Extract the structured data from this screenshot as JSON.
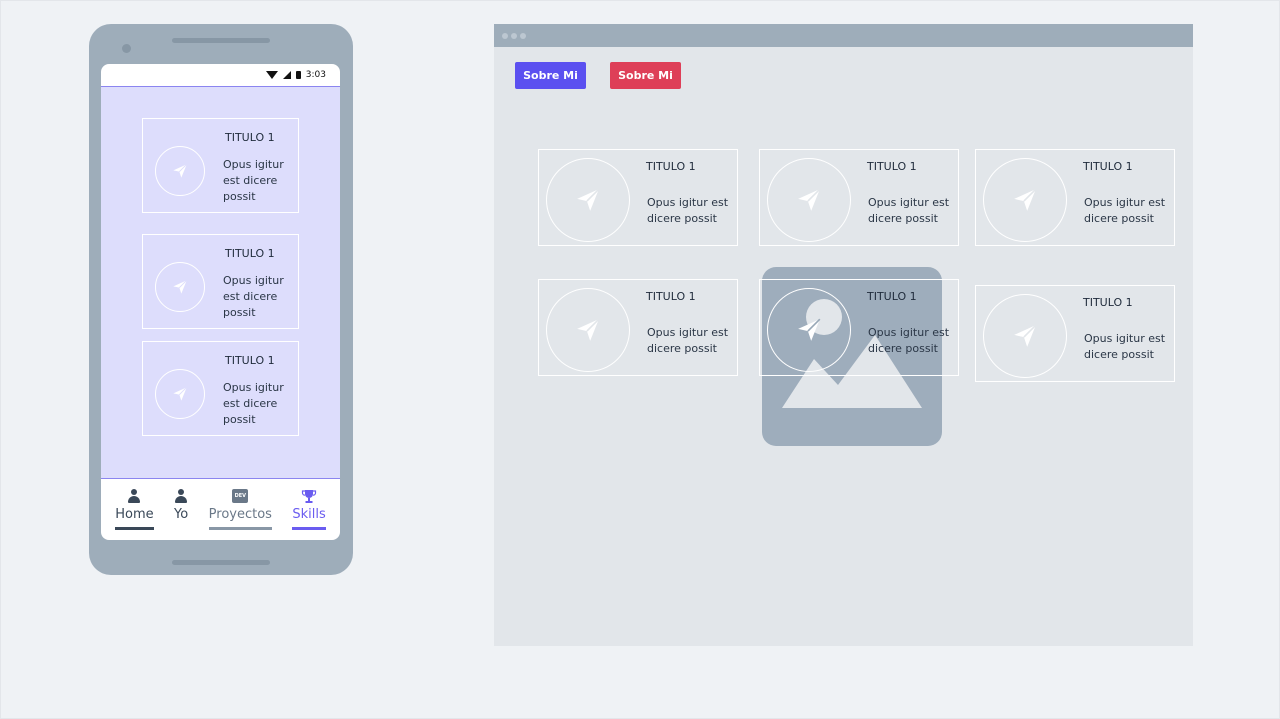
{
  "phone": {
    "status": {
      "time": "3:03"
    },
    "cards": [
      {
        "title": "TITULO 1",
        "desc": "Opus igitur est dicere possit"
      },
      {
        "title": "TITULO 1",
        "desc": "Opus igitur est dicere possit"
      },
      {
        "title": "TITULO 1",
        "desc": "Opus igitur est dicere possit"
      }
    ],
    "nav": [
      {
        "label": "Home",
        "icon": "person-icon"
      },
      {
        "label": "Yo",
        "icon": "person-icon"
      },
      {
        "label": "Proyectos",
        "icon": "dev-icon",
        "icon_text": "DEV"
      },
      {
        "label": "Skills",
        "icon": "trophy-icon"
      }
    ]
  },
  "browser": {
    "buttons": {
      "about": "Sobre Mi",
      "skills": "Sobre Mi"
    },
    "cards": [
      {
        "title": "TITULO 1",
        "desc": "Opus igitur est dicere possit"
      },
      {
        "title": "TITULO 1",
        "desc": "Opus igitur est dicere possit"
      },
      {
        "title": "TITULO 1",
        "desc": "Opus igitur est dicere possit"
      },
      {
        "title": "TITULO 1",
        "desc": "Opus igitur est dicere possit"
      },
      {
        "title": "TITULO 1",
        "desc": "Opus igitur est dicere possit"
      },
      {
        "title": "TITULO 1",
        "desc": "Opus igitur est dicere possit"
      }
    ]
  },
  "colors": {
    "accent": "#5b50f0",
    "danger": "#de3f58",
    "frame": "#9eadba",
    "phone_bg": "#ddddfc"
  },
  "icons": {
    "card": "paper-plane-icon",
    "placeholder": "image-placeholder-icon"
  }
}
